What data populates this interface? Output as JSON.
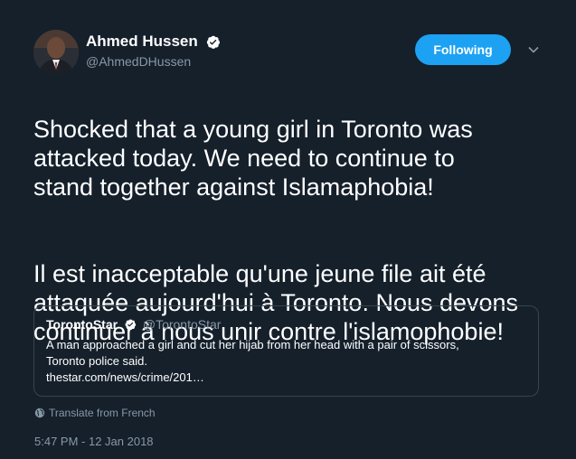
{
  "user": {
    "display_name": "Ahmed Hussen",
    "handle": "@AhmedDHussen",
    "follow_label": "Following"
  },
  "tweet": {
    "paragraphs": [
      "Shocked that a young girl in Toronto was\nattacked today.  We need to continue to\nstand together against Islamaphobia!",
      "Il est inacceptable qu'une jeune file ait été\nattaquée aujourd'hui à Toronto. Nous devons\ncontinuer à nous unir contre l'islamophobie!"
    ],
    "translate_label": "Translate from French",
    "timestamp": "5:47 PM - 12 Jan 2018"
  },
  "quoted": {
    "name": "TorontoStar",
    "handle": "@TorontoStar",
    "text_line1": "A man approached a girl and cut her hijab from her head with a pair of scissors,",
    "text_line2": "Toronto police said.",
    "link": "thestar.com/news/crime/201…"
  },
  "colors": {
    "background": "#15202b",
    "accent": "#1da1f2",
    "secondary_text": "#8899a6",
    "border": "#38444d"
  },
  "icons": [
    "verified-badge-icon",
    "chevron-down-icon",
    "globe-icon"
  ]
}
